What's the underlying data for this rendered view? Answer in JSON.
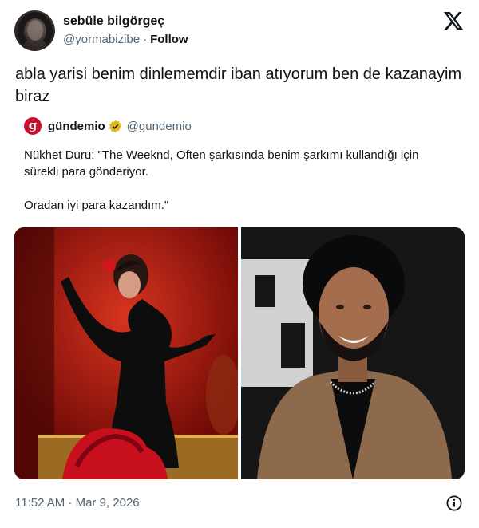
{
  "author": {
    "name": "sebüle bilgörgeç",
    "handle": "@yormabizibe",
    "separator": "·",
    "follow_label": "Follow"
  },
  "tweet": {
    "text": "abla yarisi benim dinlememdir iban atıyorum ben de kazanayim biraz"
  },
  "quote": {
    "logo_letter": "g",
    "name": "gündemio",
    "handle": "@gundemio",
    "paragraphs": [
      "Nükhet Duru: \"The Weeknd, Often şarkısında benim şarkımı kullandığı için sürekli para gönderiyor.",
      "Oradan iyi para kazandım.\""
    ]
  },
  "media": {
    "left_image": "singer-on-stage-photo",
    "right_image": "man-smiling-portrait-photo"
  },
  "meta": {
    "timestamp": "11:52 AM · Mar 9, 2026"
  },
  "icons": {
    "brand": "x-logo-icon",
    "verified": "verified-badge-icon",
    "info": "info-icon"
  },
  "colors": {
    "text": "#0f1419",
    "secondary": "#536471",
    "brand_red": "#c8102e",
    "verified_gold": "#e2b719"
  }
}
